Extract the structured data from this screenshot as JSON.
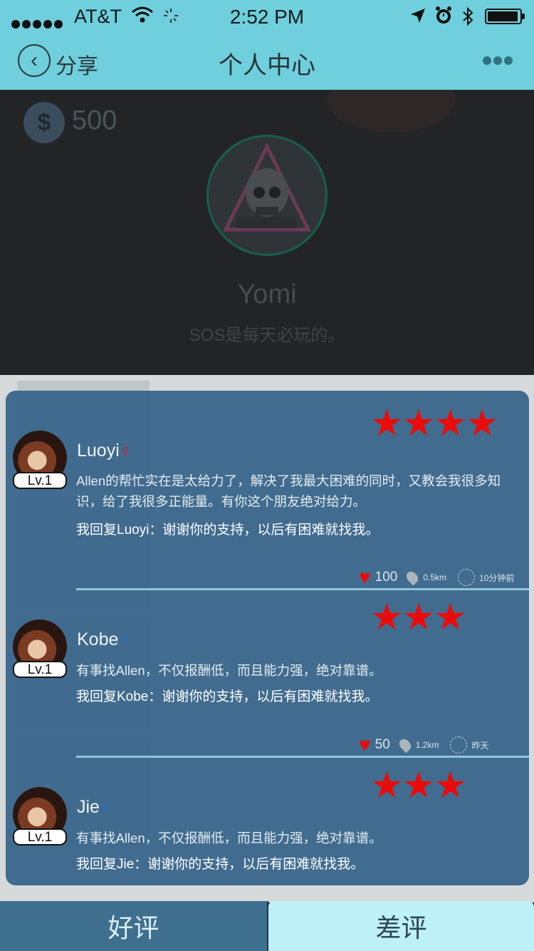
{
  "status_bar": {
    "carrier": "AT&T",
    "time": "2:52 PM",
    "battery_level": 0.95
  },
  "nav": {
    "back_label": "分享",
    "title": "个人中心"
  },
  "profile": {
    "coins": "500",
    "name": "Yomi",
    "motto": "SOS是每天必玩的。"
  },
  "reviews": [
    {
      "user": "Luoyi",
      "gender": "female",
      "gender_symbol": "♀",
      "level": "Lv.1",
      "rating": 4,
      "stars": "★★★★",
      "text": "Allen的帮忙实在是太给力了，解决了我最大困难的同时，又教会我很多知识，给了我很多正能量。有你这个朋友绝对给力。",
      "reply": "我回复Luoyi：谢谢你的支持，以后有困难就找我。",
      "likes": "100",
      "distance": "0.5km",
      "time": "10分钟前"
    },
    {
      "user": "Kobe",
      "gender": "male",
      "gender_symbol": "♂",
      "level": "Lv.1",
      "rating": 3,
      "stars": "★★★",
      "text": "有事找Allen，不仅报酬低，而且能力强，绝对靠谱。",
      "reply": "我回复Kobe：谢谢你的支持，以后有困难就找我。",
      "likes": "50",
      "distance": "1.2km",
      "time": "昨天"
    },
    {
      "user": "Jie",
      "gender": "male",
      "gender_symbol": "♂",
      "level": "Lv.1",
      "rating": 3,
      "stars": "★★★",
      "text": "有事找Allen，不仅报酬低，而且能力强，绝对靠谱。",
      "reply": "我回复Jie：谢谢你的支持，以后有困难就找我。"
    }
  ],
  "tabs": {
    "good": "好评",
    "bad": "差评"
  }
}
